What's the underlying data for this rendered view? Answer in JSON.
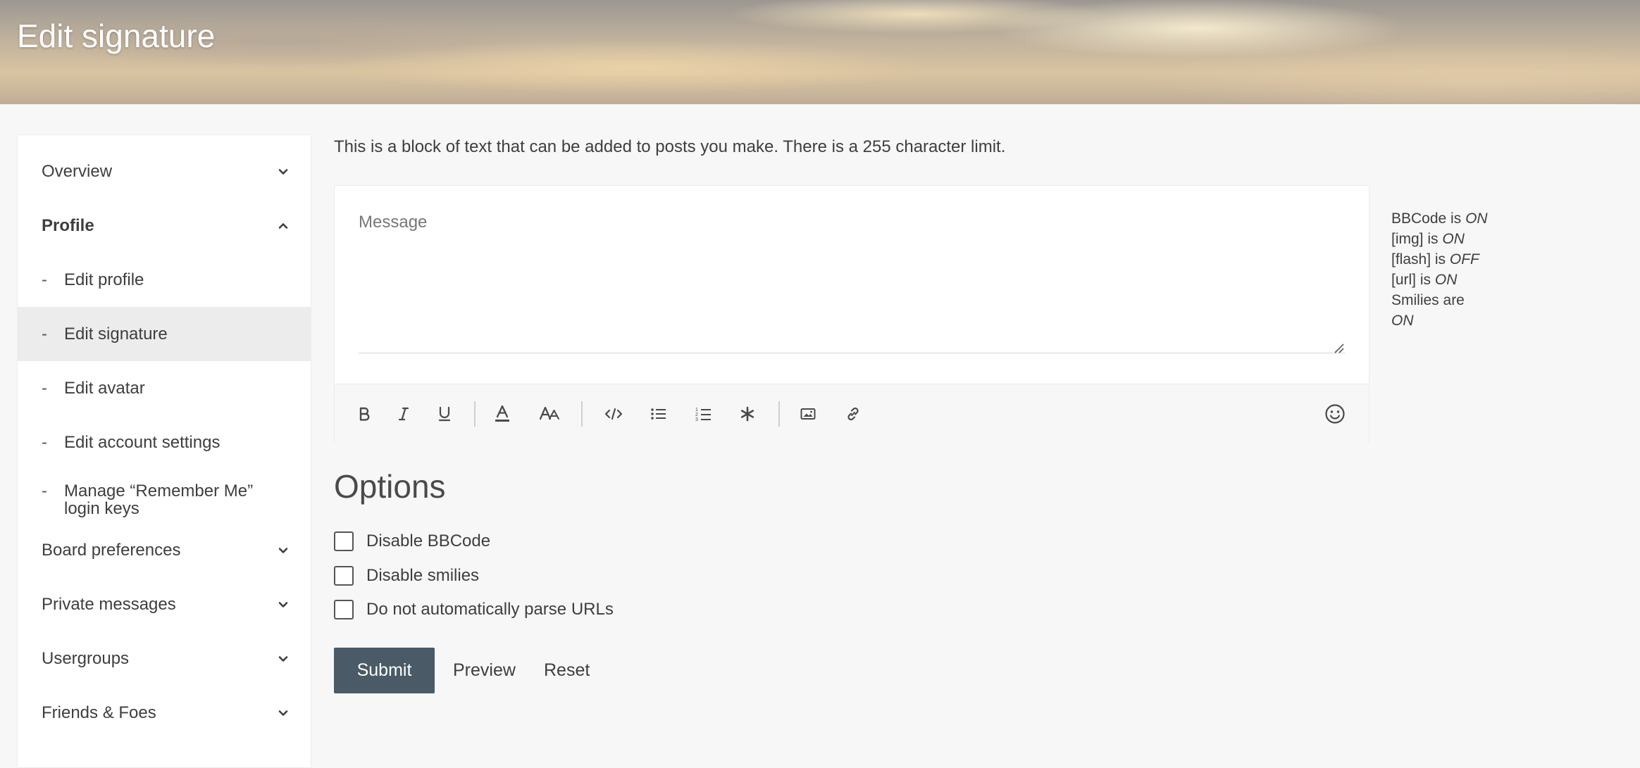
{
  "header": {
    "title": "Edit signature"
  },
  "sidebar": {
    "items": [
      {
        "label": "Overview",
        "icon": "chevron-down-icon"
      },
      {
        "label": "Profile",
        "icon": "chevron-up-icon"
      },
      {
        "label": "Board preferences",
        "icon": "chevron-down-icon"
      },
      {
        "label": "Private messages",
        "icon": "chevron-down-icon"
      },
      {
        "label": "Usergroups",
        "icon": "chevron-down-icon"
      },
      {
        "label": "Friends & Foes",
        "icon": "chevron-down-icon"
      }
    ],
    "profile_subitems": [
      {
        "dash": "-",
        "label": "Edit profile"
      },
      {
        "dash": "-",
        "label": "Edit signature",
        "active": true
      },
      {
        "dash": "-",
        "label": "Edit avatar"
      },
      {
        "dash": "-",
        "label": "Edit account settings"
      },
      {
        "dash": "-",
        "label": "Manage “Remember Me” login keys"
      }
    ]
  },
  "main": {
    "intro": "This is a block of text that can be added to posts you make. There is a 255 character limit.",
    "message": {
      "placeholder": "Message",
      "value": ""
    },
    "toolbar": [
      "bold-icon",
      "italic-icon",
      "underline-icon",
      "font-color-icon",
      "font-size-icon",
      "code-icon",
      "bullet-list-icon",
      "numbered-list-icon",
      "asterisk-icon",
      "image-icon",
      "link-icon",
      "smiley-icon"
    ],
    "status": {
      "bbcode": {
        "label": "BBCode is",
        "state": "ON"
      },
      "img": {
        "label": "[img] is",
        "state": "ON"
      },
      "flash": {
        "label": "[flash] is",
        "state": "OFF"
      },
      "url": {
        "label": "[url] is",
        "state": "ON"
      },
      "smilies": {
        "label": "Smilies are",
        "state": "ON"
      }
    },
    "options": {
      "title": "Options",
      "checkboxes": [
        {
          "label": "Disable BBCode",
          "checked": false
        },
        {
          "label": "Disable smilies",
          "checked": false
        },
        {
          "label": "Do not automatically parse URLs",
          "checked": false
        }
      ]
    },
    "actions": {
      "submit": "Submit",
      "preview": "Preview",
      "reset": "Reset"
    }
  },
  "colors": {
    "submit_bg": "#4a5a66",
    "active_nav_bg": "#ececec",
    "page_bg": "#f7f7f7"
  }
}
